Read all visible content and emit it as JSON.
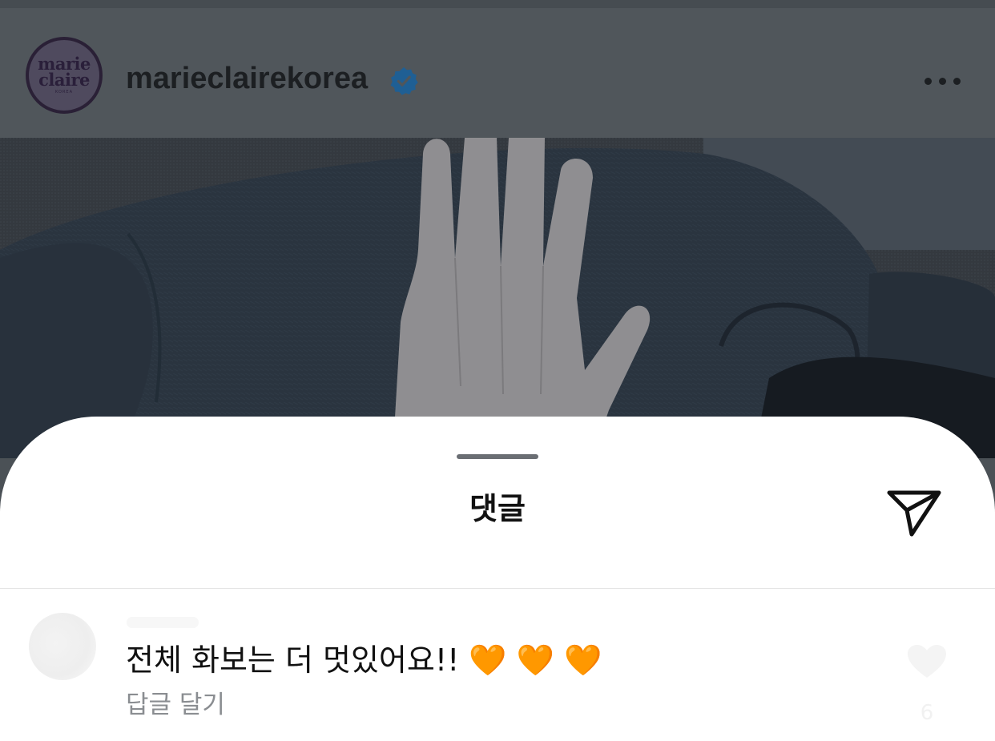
{
  "post": {
    "username": "marieclairekorea",
    "avatar": {
      "logo_line1": "marie",
      "logo_line2": "claire",
      "logo_sub": "KOREA"
    },
    "verified_icon": "verified-badge-icon",
    "more_icon": "more-horizontal-icon",
    "colors": {
      "verified": "#1f6fb6",
      "avatar_border": "#2a2036"
    }
  },
  "comments_sheet": {
    "title": "댓글",
    "share_icon": "send-icon",
    "comments": [
      {
        "text": "전체 화보는 더 멋있어요!! 🧡 🧡 🧡",
        "reply_label": "답글 달기",
        "like_icon": "heart-icon",
        "like_count": "6"
      }
    ]
  }
}
